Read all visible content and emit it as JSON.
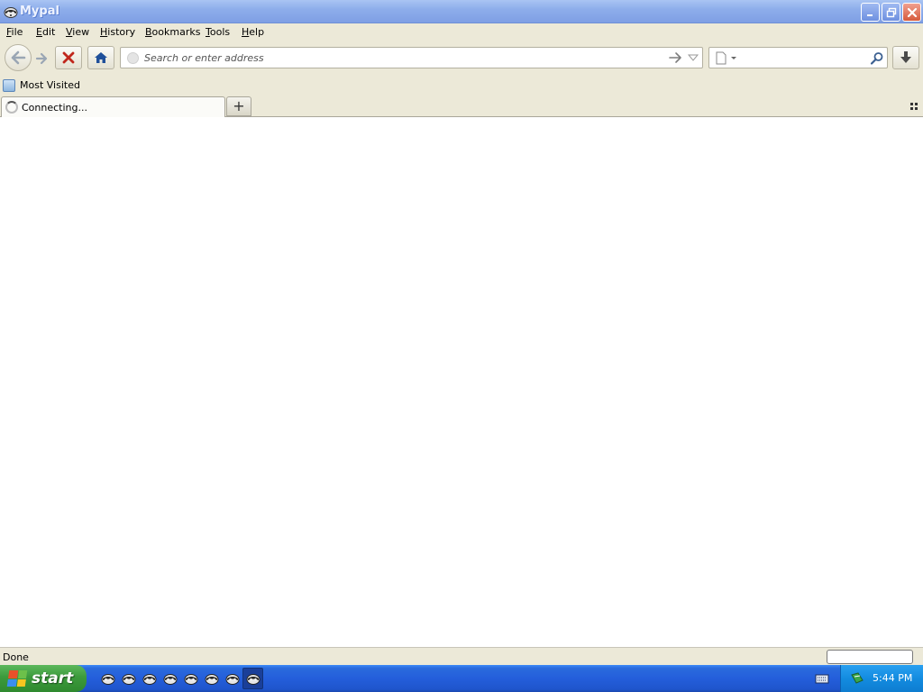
{
  "window": {
    "title": "Mypal"
  },
  "menu": [
    {
      "label": "File",
      "accel": "F",
      "rest": "ile"
    },
    {
      "label": "Edit",
      "accel": "E",
      "rest": "dit"
    },
    {
      "label": "View",
      "accel": "V",
      "rest": "iew"
    },
    {
      "label": "History",
      "accel": "H",
      "rest": "istory"
    },
    {
      "label": "Bookmarks",
      "accel": "B",
      "rest": "ookmarks"
    },
    {
      "label": "Tools",
      "accel": "T",
      "rest": "ools"
    },
    {
      "label": "Help",
      "accel": "H",
      "rest": "elp"
    }
  ],
  "navbar": {
    "url_value": "",
    "url_placeholder": "Search or enter address",
    "search_value": ""
  },
  "bookmarks": {
    "items": [
      {
        "label": "Most Visited",
        "icon": "folder-icon"
      }
    ]
  },
  "tabs": [
    {
      "label": "Connecting...",
      "loading": true
    }
  ],
  "newtab": {
    "label": "+"
  },
  "status": {
    "text": "Done"
  },
  "taskbar": {
    "start_label": "start",
    "app_icons": 8,
    "clock": "5:44 PM"
  },
  "colors": {
    "titlebar": "#8eaeeb",
    "chrome": "#ece9d8",
    "taskbar": "#245edb",
    "start": "#3c9a3c",
    "close": "#d65a3c"
  }
}
